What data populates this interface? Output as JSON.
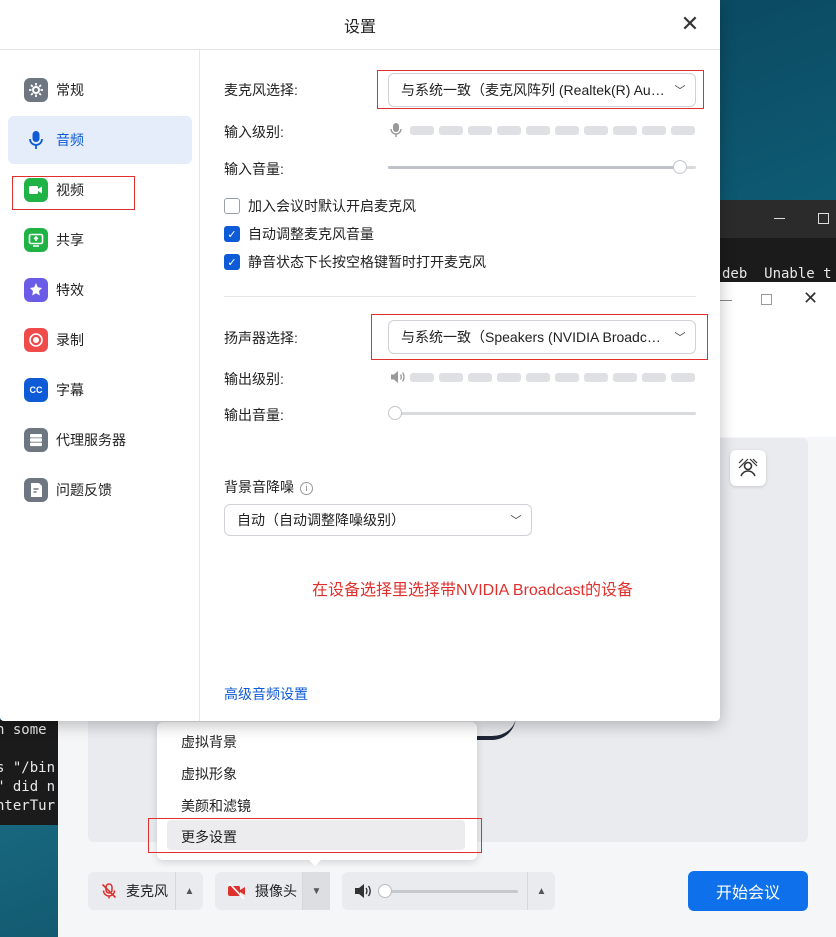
{
  "settings": {
    "title": "设置",
    "sidebar": [
      {
        "label": "常规",
        "icon": "gear-icon",
        "color": "#6e7681"
      },
      {
        "label": "音频",
        "icon": "microphone-icon",
        "color": "#0e5bd8"
      },
      {
        "label": "视频",
        "icon": "video-camera-icon",
        "color": "#1fb345"
      },
      {
        "label": "共享",
        "icon": "share-screen-icon",
        "color": "#1fb345"
      },
      {
        "label": "特效",
        "icon": "effects-icon",
        "color": "#6b5ce7"
      },
      {
        "label": "录制",
        "icon": "record-icon",
        "color": "#f04b4b"
      },
      {
        "label": "字幕",
        "icon": "captions-icon",
        "color": "#0e5bd8"
      },
      {
        "label": "代理服务器",
        "icon": "proxy-server-icon",
        "color": "#6e7681"
      },
      {
        "label": "问题反馈",
        "icon": "feedback-icon",
        "color": "#6e7681"
      }
    ],
    "audio": {
      "mic_select_label": "麦克风选择:",
      "mic_select_value": "与系统一致（麦克风阵列 (Realtek(R) Audio)）",
      "input_level_label": "输入级别:",
      "input_volume_label": "输入音量:",
      "input_volume_value": 0.97,
      "checkboxes": [
        {
          "label": "加入会议时默认开启麦克风",
          "checked": false
        },
        {
          "label": "自动调整麦克风音量",
          "checked": true
        },
        {
          "label": "静音状态下长按空格键暂时打开麦克风",
          "checked": true
        }
      ],
      "speaker_select_label": "扬声器选择:",
      "speaker_select_value": "与系统一致（Speakers (NVIDIA Broadcast)）",
      "output_level_label": "输出级别:",
      "output_volume_label": "输出音量:",
      "output_volume_value": 0.0,
      "noise_label": "背景音降噪",
      "noise_value": "自动（自动调整降噪级别）",
      "annotation": "在设备选择里选择带NVIDIA Broadcast的设备",
      "advanced_link": "高级音频设置"
    }
  },
  "popup_menu": {
    "items": [
      "虚拟背景",
      "虚拟形象",
      "美颜和滤镜",
      "更多设置"
    ],
    "highlighted": "更多设置"
  },
  "toolbar": {
    "mic_label": "麦克风",
    "camera_label": "摄像头",
    "start_label": "开始会议",
    "speaker_volume": 0.0
  },
  "terminal": {
    "line1": "deb  Unable t",
    "left_lines": [
      "h some",
      "",
      "s \"/bin",
      "\" did n",
      "nterTur"
    ]
  },
  "colors": {
    "accent": "#0e5bd8",
    "start_button": "#0e71eb",
    "annotation_red": "#e0302d"
  }
}
